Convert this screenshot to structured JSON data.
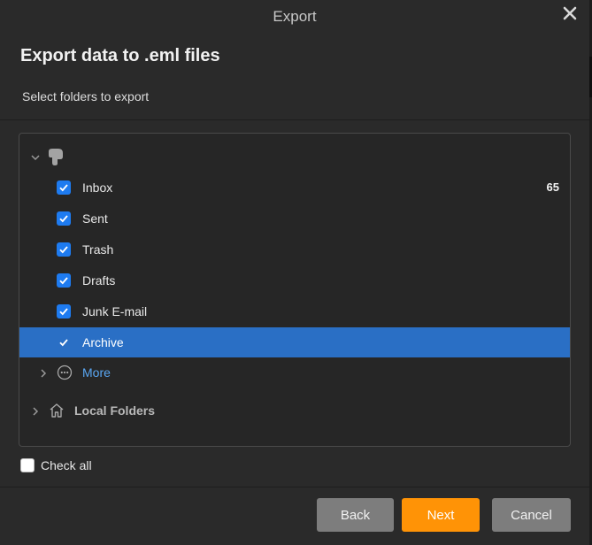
{
  "dialog": {
    "title": "Export",
    "heading": "Export data to .eml files",
    "subheading": "Select folders to export"
  },
  "account": {
    "logo_icon": "account-logo-icon",
    "expanded": true
  },
  "folders": [
    {
      "label": "Inbox",
      "checked": true,
      "count": "65",
      "selected": false
    },
    {
      "label": "Sent",
      "checked": true,
      "count": "",
      "selected": false
    },
    {
      "label": "Trash",
      "checked": true,
      "count": "",
      "selected": false
    },
    {
      "label": "Drafts",
      "checked": true,
      "count": "",
      "selected": false
    },
    {
      "label": "Junk E-mail",
      "checked": true,
      "count": "",
      "selected": false
    },
    {
      "label": "Archive",
      "checked": true,
      "count": "",
      "selected": true
    }
  ],
  "more": {
    "label": "More",
    "icon": "more-options-icon"
  },
  "local_folders": {
    "label": "Local Folders",
    "icon": "home-icon"
  },
  "check_all": {
    "label": "Check all",
    "checked": false
  },
  "buttons": {
    "back": "Back",
    "next": "Next",
    "cancel": "Cancel"
  },
  "colors": {
    "accent": "#1e7bf0",
    "selection": "#2a6fc5",
    "primary_button": "#ff9306",
    "secondary_button": "#7d7d7d",
    "link": "#5aa7f3",
    "background": "#2a2a2a"
  }
}
